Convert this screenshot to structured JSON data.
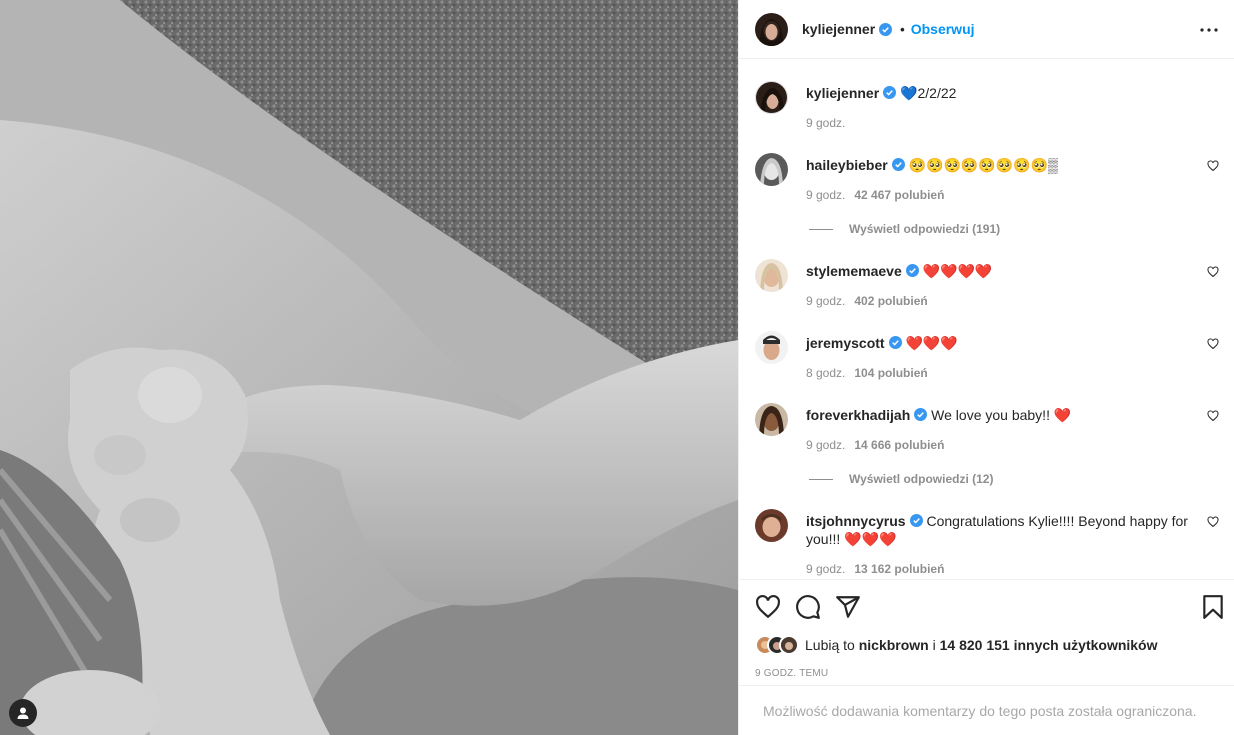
{
  "post": {
    "author": "kyliejenner",
    "follow_label": "Obserwuj",
    "separator": "•"
  },
  "caption": {
    "username": "kyliejenner",
    "text": "💙2/2/22",
    "time": "9 godz."
  },
  "comments": [
    {
      "username": "haileybieber",
      "text": "🥺🥺🥺🥺🥺🥺🥺🥺▒",
      "time": "9 godz.",
      "likes": "42 467 polubień",
      "replies": "Wyświetl odpowiedzi (191)"
    },
    {
      "username": "stylememaeve",
      "text": "❤️❤️❤️❤️",
      "time": "9 godz.",
      "likes": "402 polubień"
    },
    {
      "username": "jeremyscott",
      "text": "❤️❤️❤️",
      "time": "8 godz.",
      "likes": "104 polubień"
    },
    {
      "username": "foreverkhadijah",
      "text": "We love you baby!! ❤️",
      "time": "9 godz.",
      "likes": "14 666 polubień",
      "replies": "Wyświetl odpowiedzi (12)"
    },
    {
      "username": "itsjohnnycyrus",
      "text": "Congratulations Kylie!!!! Beyond happy for you!!! ❤️❤️❤️",
      "time": "9 godz.",
      "likes": "13 162 polubień"
    }
  ],
  "likes_summary": {
    "prefix": "Lubią to",
    "user": "nickbrown",
    "conj": "i",
    "others": "14 820 151 innych użytkowników"
  },
  "post_time": "9 godz. temu",
  "restricted_notice": "Możliwość dodawania komentarzy do tego posta została ograniczona.",
  "colors": {
    "accent": "#0095f6",
    "verified": "#3897f0",
    "text_primary": "#262626",
    "text_secondary": "#8e8e8e"
  },
  "icons": {
    "more": "more-horizontal-icon",
    "like": "heart-icon",
    "comment": "comment-icon",
    "share": "share-icon",
    "save": "bookmark-icon",
    "tag": "user-tag-icon"
  }
}
